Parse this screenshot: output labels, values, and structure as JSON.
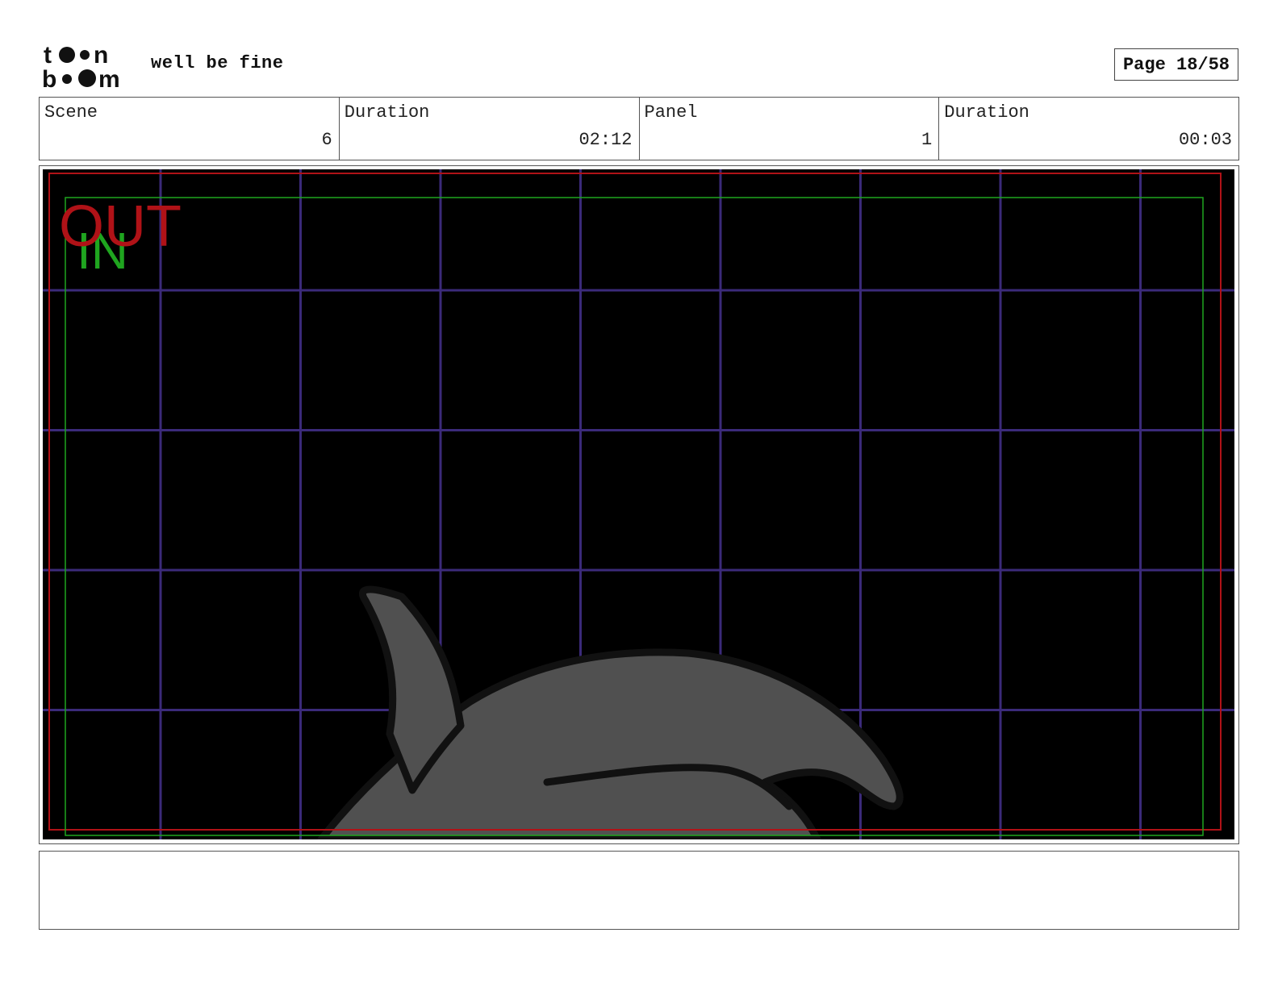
{
  "header": {
    "logo_text_top": "toon",
    "logo_text_bottom": "boom",
    "title": "well be fine",
    "page_label": "Page 18/58"
  },
  "info": [
    {
      "label": "Scene",
      "value": "6"
    },
    {
      "label": "Duration",
      "value": "02:12"
    },
    {
      "label": "Panel",
      "value": "1"
    },
    {
      "label": "Duration",
      "value": "00:03"
    }
  ],
  "panel": {
    "background_color": "#000000",
    "grid_color": "#3b2a7a",
    "grid_columns": 9,
    "grid_rows": 5,
    "safe_area_out_label": "OUT",
    "safe_area_out_color": "#b01217",
    "safe_area_in_label": "IN",
    "safe_area_in_color": "#1fa51f",
    "drawing_fill": "#505050",
    "drawing_stroke": "#111111"
  },
  "notes": {
    "text": ""
  }
}
